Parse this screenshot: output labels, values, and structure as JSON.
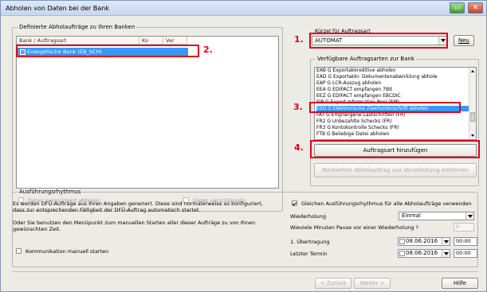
{
  "window": {
    "title": "Abholen von Daten bei der Bank"
  },
  "left_group": {
    "title": "Definierte Abholaufträge zu Ihren Banken",
    "columns": [
      "Bank / Auftragsart",
      "Ko",
      "Ver"
    ],
    "rows": [
      {
        "label": "Evangelische Bank (EB_SCH)"
      }
    ],
    "compress_label": "Daten komprimiert abholen",
    "encrypt_label": "Daten verschlüsseln"
  },
  "right": {
    "kuerzel_label": "Kürzel für Auftragsart",
    "kuerzel_value": "AUTOMAT",
    "new_button": "Neu",
    "available_title": "Verfügbare Auftragsarten zur Bank",
    "items": [
      "EAB G Exportakkreditive abholen",
      "EAD G Exportakkr. Dokumentenabwicklung abhole",
      "EAP G LCR-Auszug abholen",
      "EEA G EDIFACT empfangen 7Bit",
      "EEZ G EDIFACT empfangen EBCDIC",
      "EIP G Export Information Pool (EIP)",
      "ESG G Elektronische Zweitunterschrift abholen",
      "FAT G Empfangene Lastschriften (FR)",
      "FR2 G Unbezahlte Schecks (FR)",
      "FR3 G Kontokontrolle Schecks (FR)",
      "FTB G Beliebige Datei abholen"
    ],
    "selected_index": 6,
    "add_button": "Auftragsart hinzufügen",
    "remove_button": "Markierten Abholauftrag aus Verarbeitung entfernen"
  },
  "annotations": [
    "1.",
    "2.",
    "3.",
    "4."
  ],
  "rhythm": {
    "title": "Ausführungsrhythmus",
    "text1": "Es werden DFÜ-Aufträge aus Ihren Angaben generiert. Diese sind normalerweise so konfiguriert, dass zur entsprechenden Fälligkeit der DFÜ-Auftrag automatisch startet.",
    "text2": "Oder Sie benutzen den Menüpunkt zum manuellen Starten aller dieser Aufträge zu von Ihnen gewünschten Zeit.",
    "manual_label": "Kommunikation manuell starten",
    "same_rhythm_label": "Gleichen Ausführungsrhythmus für alle Abholaufträge verwenden",
    "repeat_label": "Wiederholung",
    "repeat_value": "Einmal",
    "pause_label": "Wieviele Minuten Pause vor einer Wiederholung ?",
    "pause_value": "0",
    "first_label": "1. Übertragung",
    "first_date": "08.06.2016",
    "first_time": "00:00",
    "last_label": "Letzter Termin",
    "last_date": "08.06.2016",
    "last_time": "00:00"
  },
  "footer": {
    "back": "< Zurück",
    "next": "Weiter >",
    "help": "Hilfe"
  }
}
